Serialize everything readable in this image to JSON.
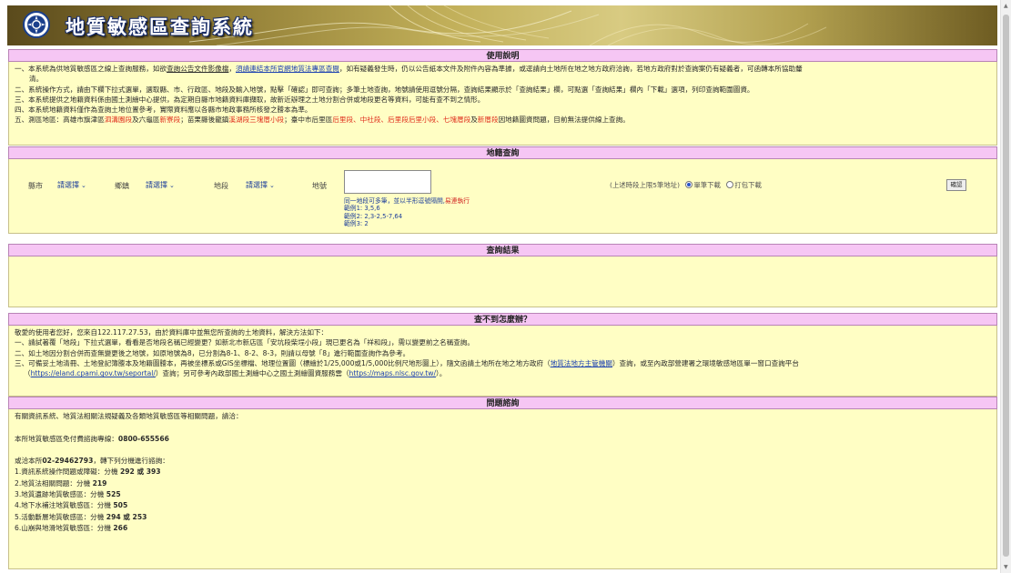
{
  "app": {
    "title": "地質敏感區查詢系統"
  },
  "usage": {
    "heading": "使用說明",
    "item1": {
      "a": "一、本系統為供地質敏感區之線上查詢服務，如欲",
      "link1": "查詢公告文件影像檔",
      "b": "，",
      "link2": "須請連結本所官網地質法專區查閱",
      "c": "，如有疑義發生時，仍以公告紙本文件及附件內容為準據，或逕請向土地所在地之地方政府洽詢，若地方政府對於查詢案仍有疑義者，可函轉本所協助釐",
      "d": "清。"
    },
    "item2": "二、系統操作方式，請由下欄下拉式選單，選取縣、市、行政區、地段及輸入地號，點擊「確認」即可查詢；多筆土地查詢，地號請使用逗號分隔，查詢結果顯示於「查詢結果」欄，可點選「查詢結果」欄內「下載」選項，列印查詢範圍圖資。",
    "item3": "三、本系統提供之地籍資料係由國土測繪中心提供，為定期自縣市地籍資料庫擷取，故新近辦理之土地分割合併或地段更名等資料，可能有查不到之情形。",
    "item4": "四、本系統地籍資料僅作為查詢土地位置參考，實際資料應以各縣市地政事務所核發之謄本為準。",
    "item5": {
      "a": "五、測區地區：高雄市旗津區",
      "r1": "泗溝園段",
      "b": "及六龜區",
      "r2": "新寮段",
      "c": "；苗栗縣後龍鎮",
      "r3": "溪湖段三塊厝小段",
      "d": "；臺中市后里區",
      "r4": "后里段、中社段、后里段后里小段、七塊厝段",
      "e": "及",
      "r5": "新厝段",
      "f": "因地籍圖資問題，目前無法提供線上查詢。"
    }
  },
  "parcel": {
    "heading": "地籍查詢",
    "county_label": "縣市",
    "county_value": "請選擇",
    "township_label": "鄉鎮",
    "township_value": "請選擇",
    "section_label": "地段",
    "section_value": "請選擇",
    "lotno_label": "地號",
    "hint_line1": "同一地段可多筆，並以半形逗號隔開,",
    "hint_red": "易連執行",
    "ex1": "範例1: 3,5,6",
    "ex2": "範例2: 2,3-2,5-7,64",
    "ex3": "範例3: 2",
    "download_note": "(上述時段上限5筆地址)",
    "option_area": "單筆下載",
    "option_pack": "打包下載",
    "confirm": "確認"
  },
  "results": {
    "heading": "查詢結果"
  },
  "help": {
    "heading": "查不到怎麼辦？",
    "intro": "敬愛的使用者您好，您來自122.117.27.53，由於資料庫中並無您所查詢的土地資料，解決方法如下：",
    "step1": "一、請試著覆「地段」下拉式選單，看看是否地段名稱已經變更？如新北市新店區「安坑段柴埕小段」現已更名為「祥和段」，需以變更前之名稱查詢。",
    "step2": "二、如土地因分割合併而查無變更後之地號，如原地號為8，已分割為8-1、8-2、8-3，則請以母號「8」進行範圍查詢作為參考。",
    "step3a": "三、可備妥土地清冊、土地登記簿謄本及地籍圖謄本，再被坐標系或GIS坐標檔、地理位置圖（標繪於1/25,000或1/5,000比例尺地形圖上），隨文函請土地所在地之地方政府（",
    "step3link": "地質法地方主管機關",
    "step3b": "）查詢，或至內政部營建署之環境敏感地區單一窗口查詢平台",
    "step3c": "（",
    "url1": "https://eland.cpami.gov.tw/seportal/",
    "step3d": "）查詢；另可參考內政部國土測繪中心之國土測繪圖資服務雲（",
    "url2": "https://maps.nlsc.gov.tw/",
    "step3e": "）。"
  },
  "contact": {
    "heading": "問題諮詢",
    "line1": "有關資訊系統、地質法相關法規疑義及各類地質敏感區等相關問題，請洽：",
    "hotline_label": "本所地質敏感區免付費諮詢專線：",
    "hotline": "0800-655566",
    "or_label": "或洽本所",
    "main_phone": "02-29462793",
    "or_suffix": "，轉下列分機進行諮詢：",
    "exts": [
      {
        "label": "1.資訊系統操作問題或障礙：分機",
        "value": "292 或 393"
      },
      {
        "label": "2.地質法相關問題：分機",
        "value": "219"
      },
      {
        "label": "3.地質遺跡地質敏感區：分機",
        "value": "525"
      },
      {
        "label": "4.地下水補注地質敏感區：分機",
        "value": "505"
      },
      {
        "label": "5.活動斷層地質敏感區：分機",
        "value": "294 或 253"
      },
      {
        "label": "6.山崩與地滑地質敏感區：分機",
        "value": "266"
      }
    ]
  },
  "colors": {
    "section_header": "#f6c6f4",
    "section_body": "#fffec4",
    "link": "#1a3fb0",
    "alert": "#e0301e",
    "banner": "#b3a150"
  },
  "icons": {
    "logo": "government-seal-icon",
    "dropdown": "chevron-down-icon"
  }
}
